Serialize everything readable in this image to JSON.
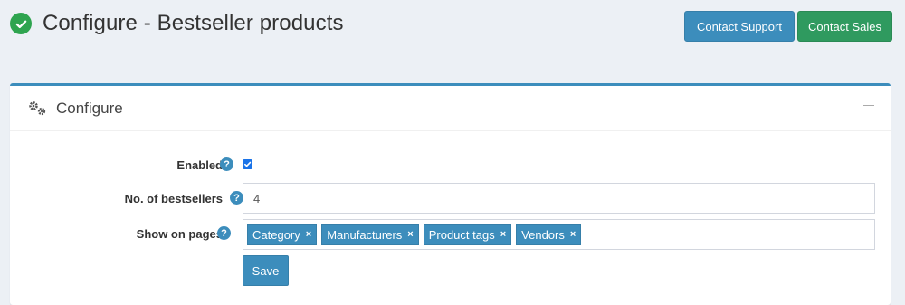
{
  "header": {
    "title": "Configure - Bestseller products",
    "contact_support": "Contact Support",
    "contact_sales": "Contact Sales"
  },
  "panel": {
    "title": "Configure",
    "fields": {
      "enabled": {
        "label": "Enabled",
        "checked": true
      },
      "bestsellers": {
        "label": "No. of bestsellers",
        "value": "4"
      },
      "show_on_pages": {
        "label": "Show on pages",
        "tags": [
          "Category",
          "Manufacturers",
          "Product tags",
          "Vendors"
        ]
      }
    },
    "help_glyph": "?",
    "tag_remove_glyph": "×",
    "save_label": "Save"
  },
  "colors": {
    "primary": "#3c8dbc",
    "success": "#2f9a5f",
    "check_green": "#2ea44f",
    "background": "#ecf0f5"
  },
  "icons": [
    "check-circle-icon",
    "gears-icon",
    "minus-icon",
    "question-icon",
    "checkbox-checked-icon",
    "close-icon"
  ]
}
